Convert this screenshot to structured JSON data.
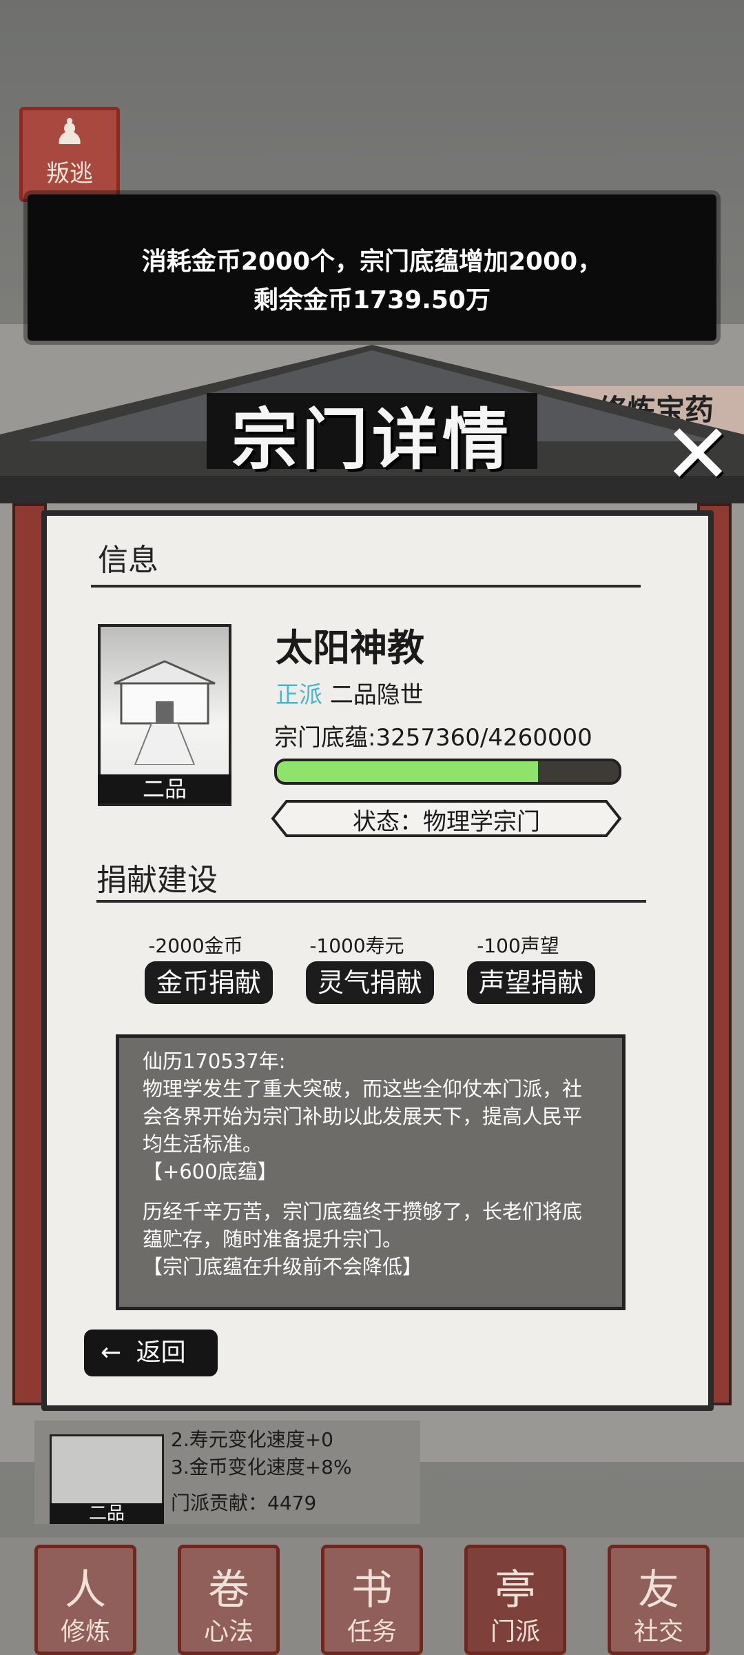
{
  "notice": {
    "line1": "消耗金币2000个，宗门底蕴增加2000，",
    "line2": "剩余金币1739.50万"
  },
  "background": {
    "escape_seal": "叛逃",
    "banner_right": "修炼宝药",
    "bottom_lines": [
      "2.寿元变化速度+0",
      "3.金币变化速度+8%"
    ],
    "contribution": "门派贡献：4479",
    "bottom_grade": "二品"
  },
  "dialog": {
    "title": "宗门详情",
    "info_header": "信息",
    "sect_name": "太阳神教",
    "alignment": "正派",
    "rank": "二品隐世",
    "foundation_label": "宗门底蕴:3257360/4260000",
    "foundation_current": 3257360,
    "foundation_max": 4260000,
    "grade_badge": "二品",
    "status": "状态：物理学宗门",
    "donate_header": "捐献建设",
    "donations": [
      {
        "cost": "-2000金币",
        "label": "金币捐献"
      },
      {
        "cost": "-1000寿元",
        "label": "灵气捐献"
      },
      {
        "cost": "-100声望",
        "label": "声望捐献"
      }
    ],
    "log": [
      "仙历170537年:",
      "物理学发生了重大突破，而这些全仰仗本门派，社",
      "会各界开始为宗门补助以此发展天下，提高人民平",
      "均生活标准。",
      "【+600底蕴】",
      "",
      "历经千辛万苦，宗门底蕴终于攒够了，长老们将底",
      "蕴贮存，随时准备提升宗门。",
      "【宗门底蕴在升级前不会降低】"
    ],
    "back_label": "返回",
    "back_arrow": "←",
    "close_symbol": "✕"
  },
  "nav": [
    {
      "label": "修炼",
      "icon": "人"
    },
    {
      "label": "心法",
      "icon": "卷"
    },
    {
      "label": "任务",
      "icon": "书"
    },
    {
      "label": "门派",
      "icon": "亭"
    },
    {
      "label": "社交",
      "icon": "友"
    }
  ],
  "colors": {
    "alignment": "#4fb3cc",
    "bar_fill": "#8fe26a",
    "pillar": "#8e3a33"
  }
}
